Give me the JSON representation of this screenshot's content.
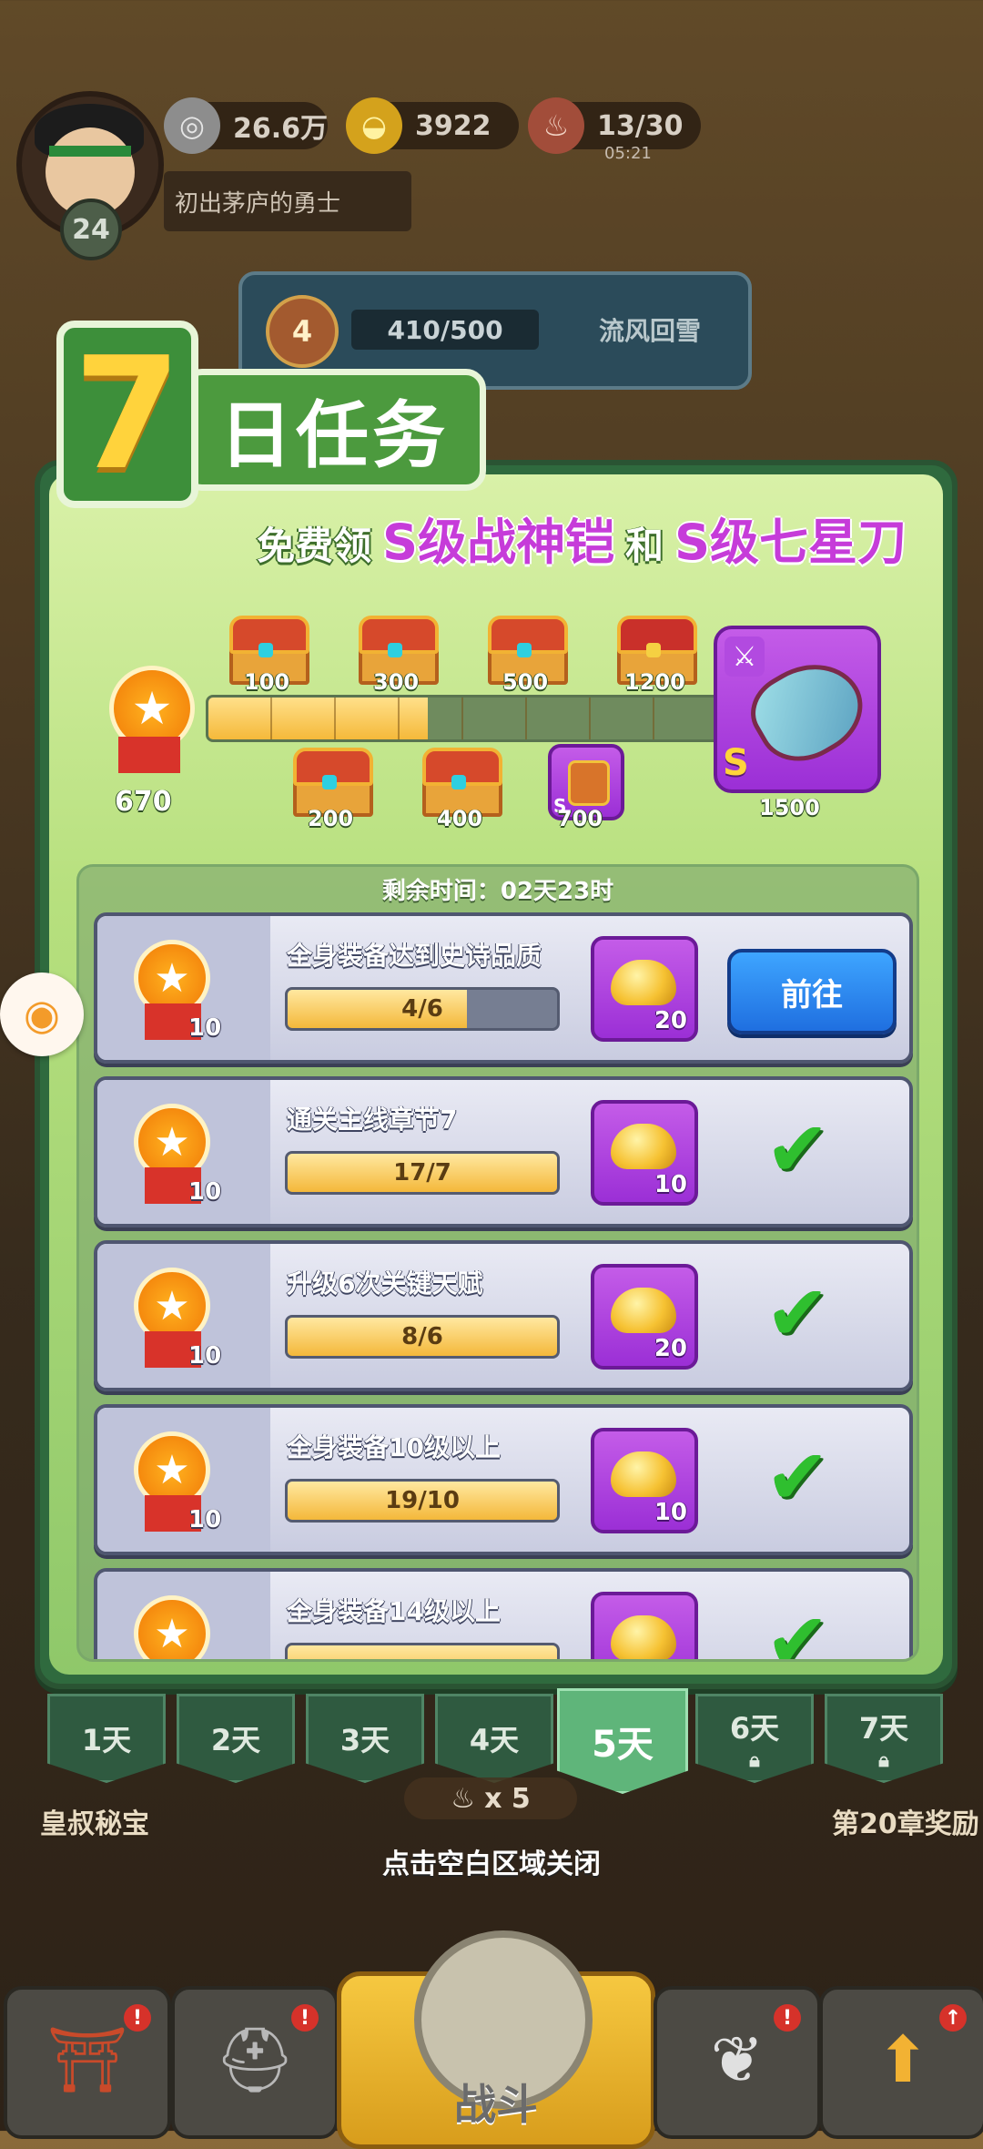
{
  "hud": {
    "level": "24",
    "silver": "26.6万",
    "gold": "3922",
    "stamina": "13/30",
    "stamina_timer": "05:21",
    "player_title": "初出茅庐的勇士",
    "stage_rank": "4",
    "stage_progress": "410/500",
    "stage_name": "流风回雪"
  },
  "panel": {
    "day_number": "7",
    "title": "日任务",
    "subtitle_prefix": "免费领",
    "reward1": "S级战神铠",
    "and_word": "和",
    "reward2": "S级七星刀",
    "points": "670",
    "milestone_progress": 0.43,
    "milestones_top": [
      "100",
      "300",
      "500",
      "1200"
    ],
    "milestones_bottom": [
      "200",
      "400",
      "700"
    ],
    "grade_letter_small": "S",
    "grand_prize_grade": "S",
    "grand_prize_points": "1500",
    "remaining_time": "剩余时间：02天23时"
  },
  "tasks": [
    {
      "name": "全身装备达到史诗品质",
      "progress": "4/6",
      "fill": 0.667,
      "medals": "10",
      "reward": "20",
      "state": "go",
      "go_label": "前往"
    },
    {
      "name": "通关主线章节7",
      "progress": "17/7",
      "fill": 1.0,
      "medals": "10",
      "reward": "10",
      "state": "done"
    },
    {
      "name": "升级6次关键天赋",
      "progress": "8/6",
      "fill": 1.0,
      "medals": "10",
      "reward": "20",
      "state": "done"
    },
    {
      "name": "全身装备10级以上",
      "progress": "19/10",
      "fill": 1.0,
      "medals": "10",
      "reward": "10",
      "state": "done"
    },
    {
      "name": "全身装备14级以上",
      "progress": "",
      "fill": 1.0,
      "medals": "",
      "reward": "",
      "state": "done"
    }
  ],
  "tabs": [
    {
      "label": "1天",
      "locked": false,
      "active": false
    },
    {
      "label": "2天",
      "locked": false,
      "active": false
    },
    {
      "label": "3天",
      "locked": false,
      "active": false
    },
    {
      "label": "4天",
      "locked": false,
      "active": false
    },
    {
      "label": "5天",
      "locked": false,
      "active": true
    },
    {
      "label": "6天",
      "locked": true,
      "active": false
    },
    {
      "label": "7天",
      "locked": true,
      "active": false
    }
  ],
  "background": {
    "left_label": "皇叔秘宝",
    "right_label": "第20章奖励",
    "meat_count": "x 5",
    "close_hint": "点击空白区域关闭"
  },
  "nav": {
    "battle_label": "战斗"
  },
  "colors": {
    "panel_green": "#b7e07e",
    "go_button": "#1f6fe0",
    "check_green": "#2fbf2f",
    "reward_purple": "#9b2fd6",
    "highlight_text": "#c63cd9"
  }
}
